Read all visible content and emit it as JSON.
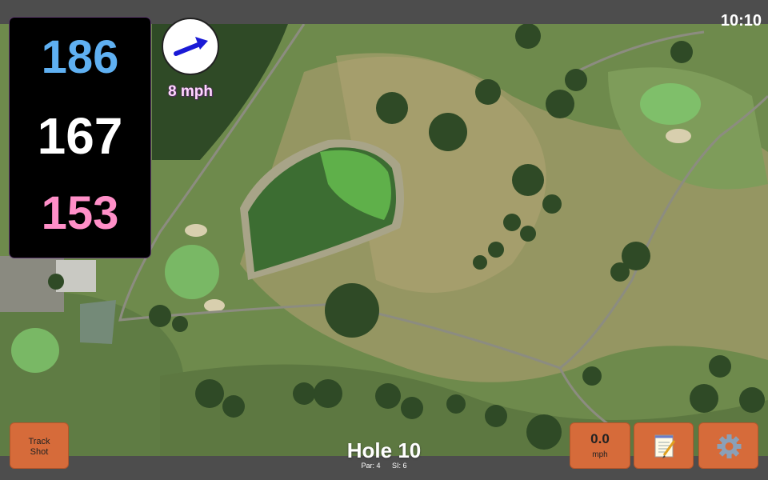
{
  "clock": "10:10",
  "distances": {
    "back": "186",
    "middle": "167",
    "front": "153"
  },
  "colors": {
    "back": "#5fb0f2",
    "middle": "#ffffff",
    "front": "#ff8fc8",
    "button": "#d66b3a"
  },
  "wind": {
    "speed_label": "8 mph",
    "icon": "wind-direction-arrow-icon"
  },
  "buttons": {
    "track_shot_line1": "Track",
    "track_shot_line2": "Shot",
    "wind_value": "0.0",
    "wind_unit": "mph",
    "notes_icon": "notepad-icon",
    "settings_icon": "gear-icon"
  },
  "hole": {
    "title": "Hole 10",
    "par_label": "Par: 4",
    "si_label": "SI: 6"
  }
}
